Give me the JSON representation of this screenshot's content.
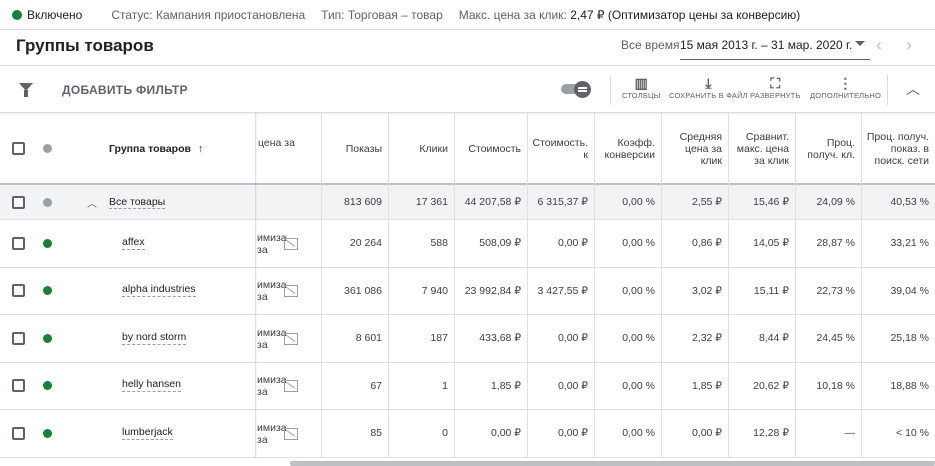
{
  "status_bar": {
    "enabled": "Включено",
    "status": "Статус: Кампания приостановлена",
    "type": "Тип: Торговая – товар",
    "max_cpc_label": "Макс. цена за клик:",
    "max_cpc_value": "2,47 ₽ (Оптимизатор цены за конверсию)",
    "enabled_color": "#188038"
  },
  "header": {
    "title": "Группы товаров",
    "date_label": "Все время",
    "date_range": "15 мая 2013 г. – 31 мар. 2020 г."
  },
  "toolbar": {
    "add_filter": "ДОБАВИТЬ ФИЛЬТР",
    "columns": "СТОЛБЦЫ",
    "save": "СОХРАНИТЬ В ФАЙЛ",
    "expand": "РАЗВЕРНУТЬ",
    "more": "ДОПОЛНИТЕЛЬНО"
  },
  "table": {
    "col_group": "Группа товаров",
    "col_hidden": "цена за",
    "columns": [
      "Показы",
      "Клики",
      "Стоимость",
      "Стоимость. к",
      "Коэфф. конверсии",
      "Средняя цена за клик",
      "Сравнит. макс. цена за клик",
      "Проц. получ. кл.",
      "Проц. получ. показ. в поиск. сети"
    ],
    "total": {
      "name": "Все товары",
      "values": [
        "813 609",
        "17 361",
        "44 207,58 ₽",
        "6 315,37 ₽",
        "0,00 %",
        "2,55 ₽",
        "15,46 ₽",
        "24,09 %",
        "40,53 %"
      ]
    },
    "hidden_text": "имизат за",
    "rows": [
      {
        "name": "affex",
        "values": [
          "20 264",
          "588",
          "508,09 ₽",
          "0,00 ₽",
          "0,00 %",
          "0,86 ₽",
          "14,05 ₽",
          "28,87 %",
          "33,21 %"
        ]
      },
      {
        "name": "alpha industries",
        "values": [
          "361 086",
          "7 940",
          "23 992,84 ₽",
          "3 427,55 ₽",
          "0,00 %",
          "3,02 ₽",
          "15,11 ₽",
          "22,73 %",
          "39,04 %"
        ]
      },
      {
        "name": "by nord storm",
        "values": [
          "8 601",
          "187",
          "433,68 ₽",
          "0,00 ₽",
          "0,00 %",
          "2,32 ₽",
          "8,44 ₽",
          "24,45 %",
          "25,18 %"
        ]
      },
      {
        "name": "helly hansen",
        "values": [
          "67",
          "1",
          "1,85 ₽",
          "0,00 ₽",
          "0,00 %",
          "1,85 ₽",
          "20,62 ₽",
          "10,18 %",
          "18,88 %"
        ]
      },
      {
        "name": "lumberjack",
        "values": [
          "85",
          "0",
          "0,00 ₽",
          "0,00 ₽",
          "0,00 %",
          "0,00 ₽",
          "12,28 ₽",
          "—",
          "< 10 %"
        ]
      }
    ]
  }
}
